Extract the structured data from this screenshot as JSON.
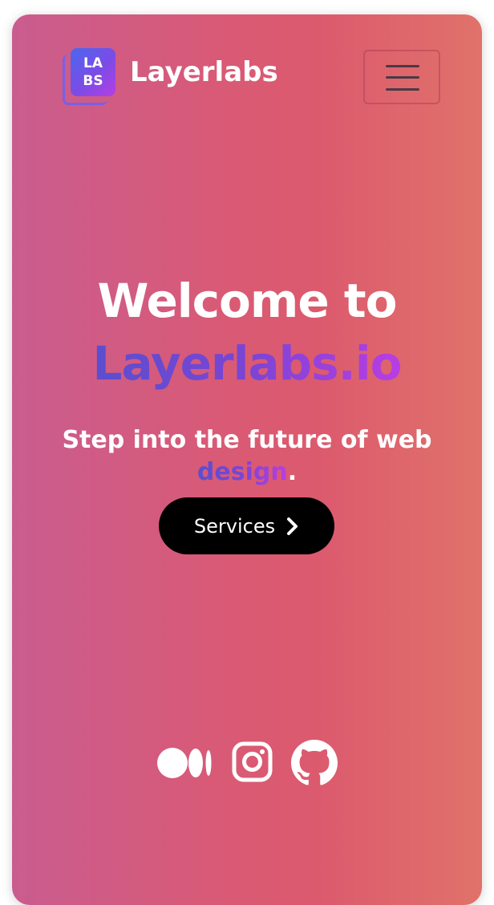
{
  "header": {
    "logo_text_line1": "LA",
    "logo_text_line2": "BS",
    "brand_name": "Layerlabs",
    "menu_icon": "hamburger-menu-icon"
  },
  "hero": {
    "title_line1": "Welcome to",
    "title_line2": "Layerlabs.io",
    "tagline_prefix": "Step into the future of web",
    "tagline_highlight": "design",
    "tagline_suffix": ".",
    "services_button_label": "Services",
    "services_button_icon": "chevron-right-icon"
  },
  "social": {
    "icons": [
      "medium-icon",
      "instagram-icon",
      "github-icon"
    ]
  },
  "colors": {
    "background_gradient": [
      "#c95c8f",
      "#dc5a6e",
      "#e0726a"
    ],
    "brand_gradient": [
      "#5b4ecf",
      "#b93de3"
    ],
    "button_bg": "#000000",
    "text_primary": "#ffffff"
  }
}
